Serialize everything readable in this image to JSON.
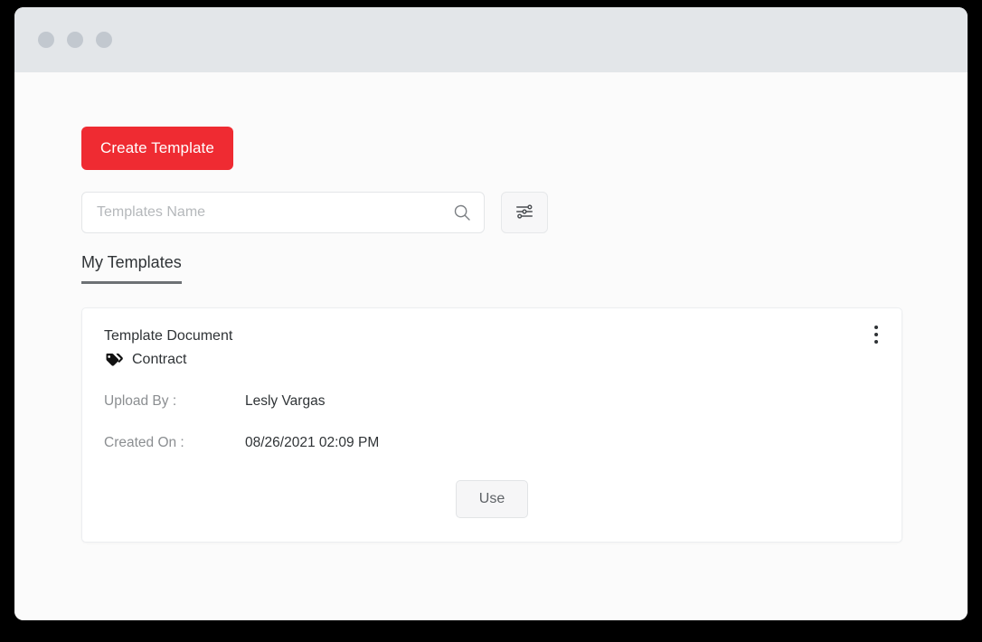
{
  "window": {
    "traffic_lights": [
      "dot-1",
      "dot-2",
      "dot-3"
    ]
  },
  "toolbar": {
    "create_label": "Create Template"
  },
  "search": {
    "placeholder": "Templates Name",
    "value": "",
    "search_icon": "search-icon",
    "filter_icon": "filter-sliders-icon"
  },
  "tabs": [
    {
      "label": "My Templates",
      "active": true
    }
  ],
  "card": {
    "title": "Template Document",
    "tag_icon": "tags-icon",
    "tag_label": "Contract",
    "menu_icon": "kebab-menu-icon",
    "fields": [
      {
        "label": "Upload By :",
        "value": "Lesly Vargas"
      },
      {
        "label": "Created On :",
        "value": "08/26/2021 02:09 PM"
      }
    ],
    "action_label": "Use"
  },
  "colors": {
    "accent_red": "#ef2b32",
    "titlebar": "#e3e6e9",
    "page_bg": "#fbfbfb",
    "card_bg": "#ffffff",
    "text_primary": "#2f3336",
    "text_muted": "#8b8e91"
  }
}
